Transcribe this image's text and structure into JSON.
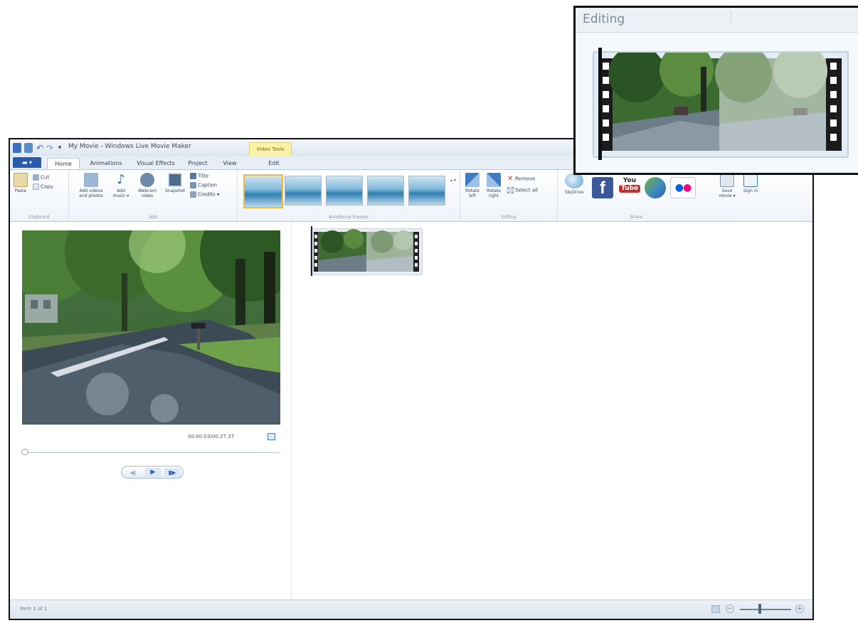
{
  "window": {
    "title": "My Movie - Windows Live Movie Maker",
    "contextual_tab": "Video Tools"
  },
  "quick_access": {
    "undo": "↶",
    "redo": "↷",
    "more": "▾"
  },
  "tabs": [
    {
      "label": "▬ ▾"
    },
    {
      "label": "Home"
    },
    {
      "label": "Animations"
    },
    {
      "label": "Visual Effects"
    },
    {
      "label": "Project"
    },
    {
      "label": "View"
    },
    {
      "label": "Edit"
    }
  ],
  "ribbon": {
    "clipboard": {
      "paste": "Paste",
      "cut": "Cut",
      "copy": "Copy",
      "group": "Clipboard"
    },
    "add": {
      "add_videos": "Add videos and photos",
      "add_music": "Add music ▾",
      "webcam": "Webcam video",
      "snapshot": "Snapshot",
      "title": "Title",
      "caption": "Caption",
      "credits": "Credits ▾",
      "group": "Add"
    },
    "themes": {
      "group": "AutoMovie themes",
      "scroll": "▴ ▾"
    },
    "editing": {
      "rotate_left": "Rotate left",
      "rotate_right": "Rotate right",
      "remove": "Remove",
      "select_all": "Select all",
      "group": "Editing"
    },
    "share": {
      "skydrive": "SkyDrive",
      "facebook": "f",
      "youtube_top": "You",
      "youtube_bottom": "Tube",
      "flickr": "●●",
      "save_movie": "Save movie ▾",
      "sign_in": "Sign in",
      "group": "Share"
    }
  },
  "preview": {
    "timecode": "00:00:03/00:27.37"
  },
  "controls": {
    "prev": "◀|",
    "play": "▶",
    "next": "▮▶"
  },
  "status": {
    "text": "Item 1 of 1",
    "zoom_out": "−",
    "zoom_in": "+"
  },
  "inset": {
    "title": "Editing"
  },
  "colors": {
    "file_tab": "#2a5bab",
    "contextual_tab": "#fbf3a8",
    "theme_selected_border": "#f0b93a",
    "facebook": "#3b5998",
    "youtube": "#c4302b",
    "flickr_blue": "#0063dc",
    "flickr_pink": "#ff0084"
  }
}
